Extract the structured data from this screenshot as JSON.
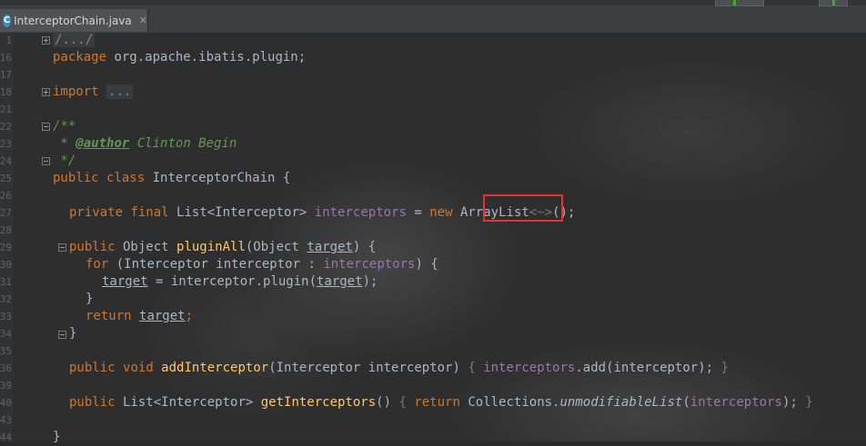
{
  "tab": {
    "icon_letter": "C",
    "filename": "InterceptorChain.java",
    "close": "✕"
  },
  "line_numbers": [
    "1",
    "16",
    "17",
    "18",
    "21",
    "22",
    "23",
    "24",
    "25",
    "26",
    "27",
    "28",
    "29",
    "30",
    "31",
    "32",
    "33",
    "34",
    "35",
    "36",
    "39",
    "40",
    "43",
    "44"
  ],
  "code": {
    "l1_fold": "/.../",
    "l16_pkg_kw": "package",
    "l16_pkg_name": " org.apache.ibatis.plugin;",
    "l18_import_kw": "import",
    "l18_import_dots": "...",
    "l22_doc_open": "/**",
    "l23_doc_star": " * ",
    "l23_doc_tag": "@author",
    "l23_doc_text": " Clinton Begin",
    "l24_doc_close": " */",
    "l25_public": "public",
    "l25_class": "class",
    "l25_name": " InterceptorChain {",
    "l27_private": "private",
    "l27_final": "final",
    "l27_type": " List<Interceptor> ",
    "l27_field": "interceptors",
    "l27_eq": " = ",
    "l27_new": "new",
    "l27_arraylist": "ArrayList",
    "l27_diamond": "<~>",
    "l27_end": "();",
    "l29_public": "public",
    "l29_ret": " Object ",
    "l29_method": "pluginAll",
    "l29_params_a": "(Object ",
    "l29_param": "target",
    "l29_params_b": ") {",
    "l30_for": "for",
    "l30_a": " (Interceptor interceptor : ",
    "l30_field": "interceptors",
    "l30_b": ") {",
    "l31_target": "target",
    "l31_a": " = interceptor.plugin(",
    "l31_target2": "target",
    "l31_b": ");",
    "l32_close": "}",
    "l33_return": "return",
    "l33_target": "target",
    "l33_semi": ";",
    "l34_close": "}",
    "l36_public": "public",
    "l36_void": "void",
    "l36_method": "addInterceptor",
    "l36_a": "(Interceptor interceptor) ",
    "l36_lb": "{ ",
    "l36_field": "interceptors",
    "l36_b": ".add(interceptor); ",
    "l36_rb": "}",
    "l40_public": "public",
    "l40_type": " List<Interceptor> ",
    "l40_method": "getInterceptors",
    "l40_a": "() ",
    "l40_lb": "{ ",
    "l40_return": "return",
    "l40_b": " Collections.",
    "l40_call": "unmodifiableList",
    "l40_c": "(",
    "l40_field": "interceptors",
    "l40_d": "); ",
    "l40_rb": "}",
    "l44_close": "}"
  },
  "colors": {
    "keyword": "#cc7832",
    "field": "#9876aa",
    "method": "#ffc66d",
    "comment": "#629755",
    "text": "#a9b7c6",
    "highlight": "#e8322b"
  }
}
